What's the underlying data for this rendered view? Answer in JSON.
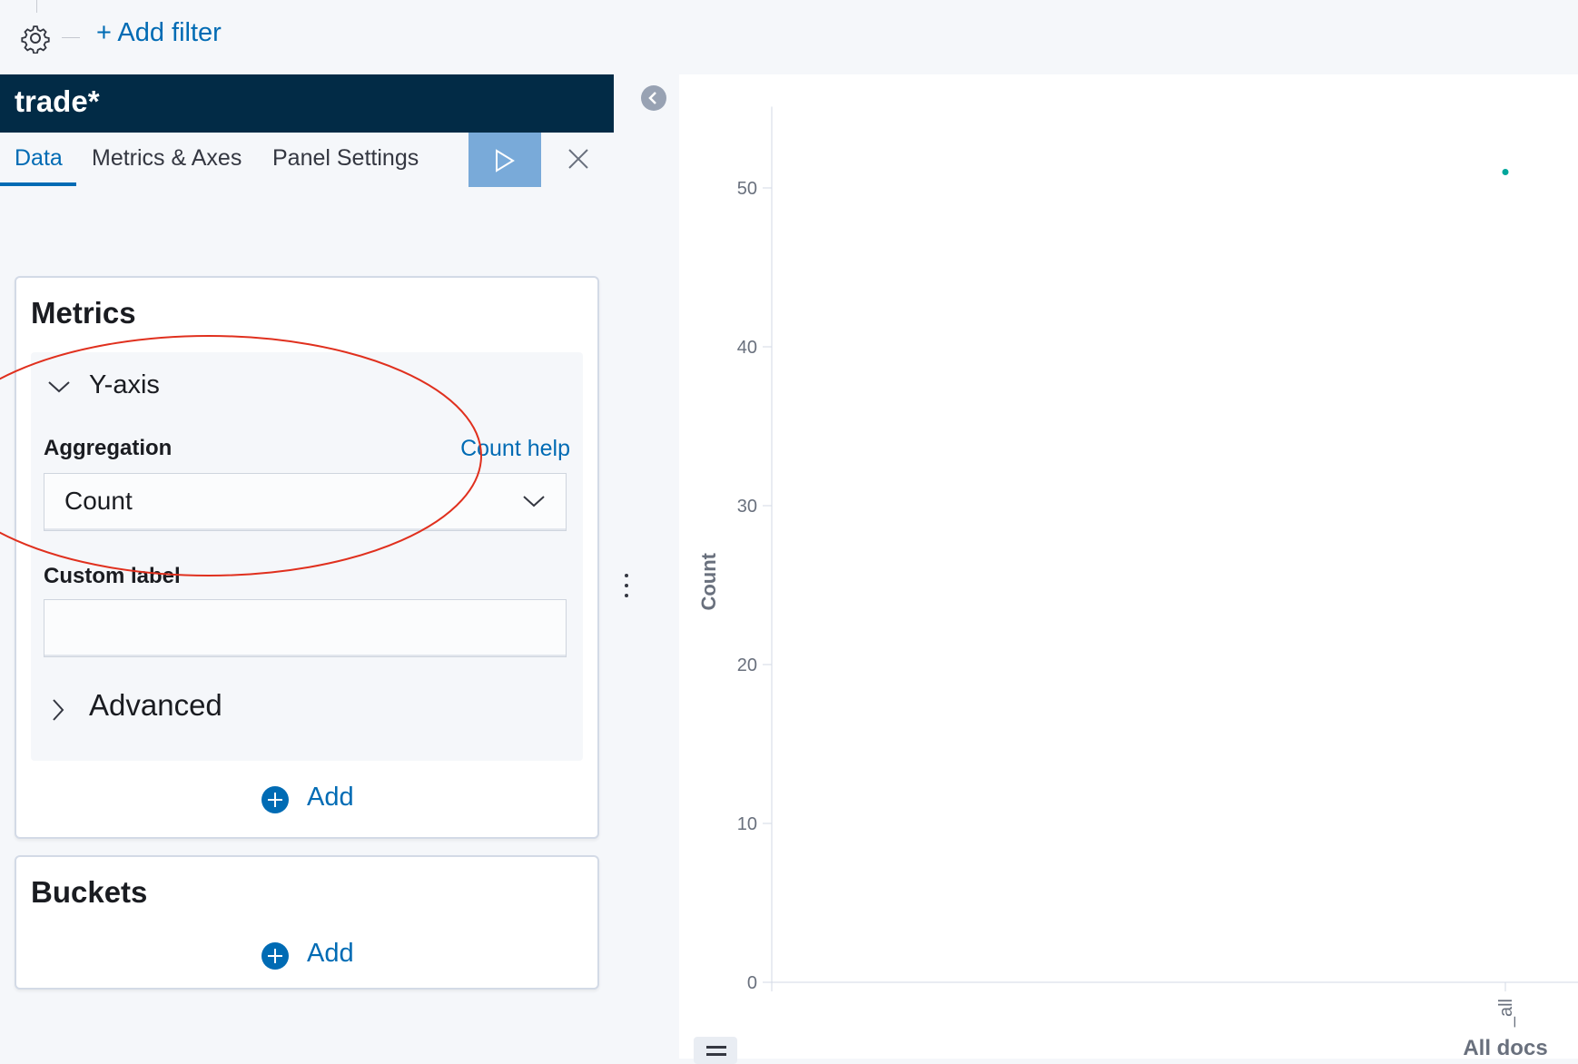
{
  "filter_bar": {
    "add_filter_label": "+ Add filter",
    "settings_icon": "gear-icon"
  },
  "editor": {
    "index_pattern": "trade*",
    "tabs": [
      {
        "label": "Data",
        "active": true
      },
      {
        "label": "Metrics & Axes",
        "active": false
      },
      {
        "label": "Panel Settings",
        "active": false
      }
    ],
    "apply_icon": "play-icon",
    "close_icon": "close-icon",
    "metrics": {
      "title": "Metrics",
      "agg": {
        "name": "Y-axis",
        "aggregation_label": "Aggregation",
        "help_link": "Count help",
        "selected": "Count",
        "custom_label_label": "Custom label",
        "custom_label_value": "",
        "advanced_label": "Advanced"
      },
      "add_label": "Add"
    },
    "buckets": {
      "title": "Buckets",
      "add_label": "Add"
    }
  },
  "colors": {
    "accent": "#006bb4",
    "header_bg": "#022b46",
    "apply_bg": "#79aad9",
    "annotation": "#e0301e",
    "series": "#00a69b"
  },
  "chart_data": {
    "type": "scatter",
    "ylabel": "Count",
    "ylim": [
      0,
      55
    ],
    "yticks": [
      0,
      10,
      20,
      30,
      40,
      50
    ],
    "categories": [
      "_all"
    ],
    "xlabel": "All docs",
    "series": [
      {
        "values": [
          51
        ]
      }
    ]
  }
}
